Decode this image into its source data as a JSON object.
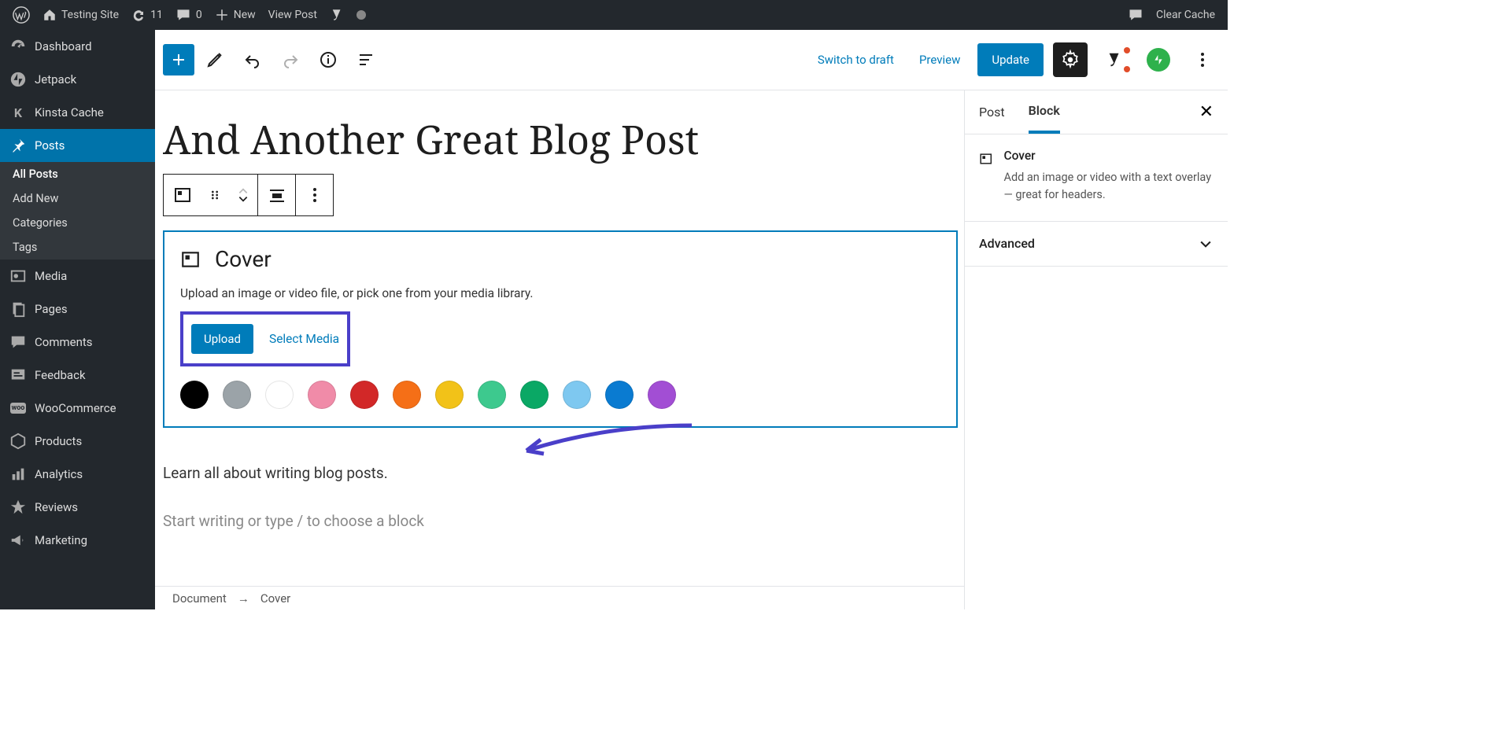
{
  "adminbar": {
    "site": "Testing Site",
    "updates": "11",
    "comments": "0",
    "new": "New",
    "viewpost": "View Post",
    "clearcache": "Clear Cache"
  },
  "adminmenu": {
    "dashboard": "Dashboard",
    "jetpack": "Jetpack",
    "kinsta": "Kinsta Cache",
    "posts": "Posts",
    "allposts": "All Posts",
    "addnew": "Add New",
    "categories": "Categories",
    "tags": "Tags",
    "media": "Media",
    "pages": "Pages",
    "commentsItem": "Comments",
    "feedback": "Feedback",
    "woocommerce": "WooCommerce",
    "products": "Products",
    "analytics": "Analytics",
    "reviews": "Reviews",
    "marketing": "Marketing"
  },
  "editor": {
    "switch": "Switch to draft",
    "preview": "Preview",
    "update": "Update",
    "title": "And Another Great Blog Post",
    "cover": {
      "label": "Cover",
      "desc": "Upload an image or video file, or pick one from your media library.",
      "upload": "Upload",
      "selectmedia": "Select Media",
      "swatches": [
        "#000000",
        "#9ba3a8",
        "#ffffff",
        "#f08ba8",
        "#d22828",
        "#f56f17",
        "#f2c218",
        "#3dc98e",
        "#0aa865",
        "#7ec8f0",
        "#0a7bd1",
        "#a24ed4"
      ]
    },
    "paragraph": "Learn all about writing blog posts.",
    "placeholder": "Start writing or type / to choose a block",
    "breadcrumb": {
      "doc": "Document",
      "arrow": "→",
      "block": "Cover"
    }
  },
  "sidebar": {
    "tab_post": "Post",
    "tab_block": "Block",
    "block": {
      "name": "Cover",
      "desc": "Add an image or video with a text overlay — great for headers."
    },
    "advanced": "Advanced"
  }
}
